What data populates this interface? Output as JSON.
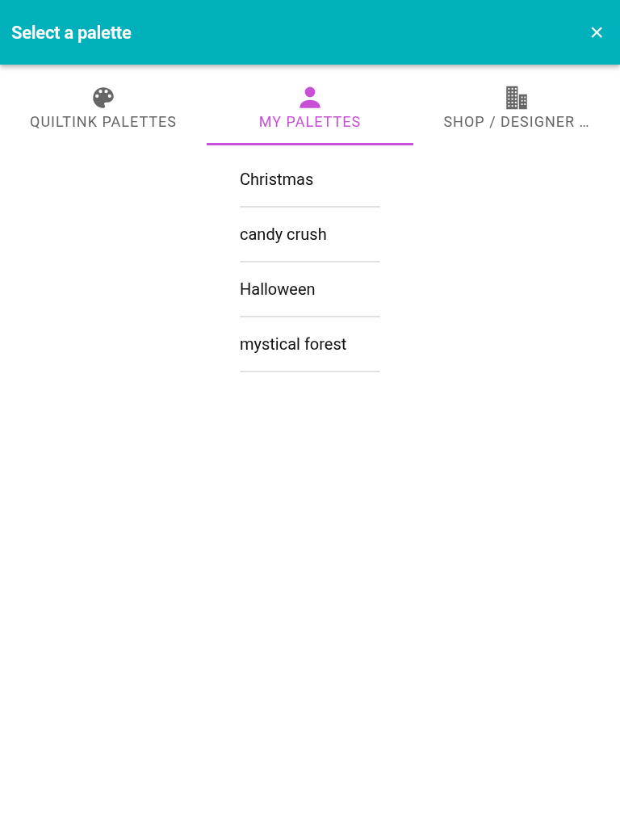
{
  "header": {
    "title": "Select a palette",
    "close": "×"
  },
  "tabs": [
    {
      "kind": "palette",
      "label": "QUILTINK PALETTES",
      "selected": false
    },
    {
      "kind": "person",
      "label": "MY PALETTES",
      "selected": true
    },
    {
      "kind": "building",
      "label": "SHOP / DESIGNER …",
      "selected": false
    }
  ],
  "palettes": [
    "Christmas",
    "candy crush",
    "Halloween",
    "mystical forest"
  ]
}
